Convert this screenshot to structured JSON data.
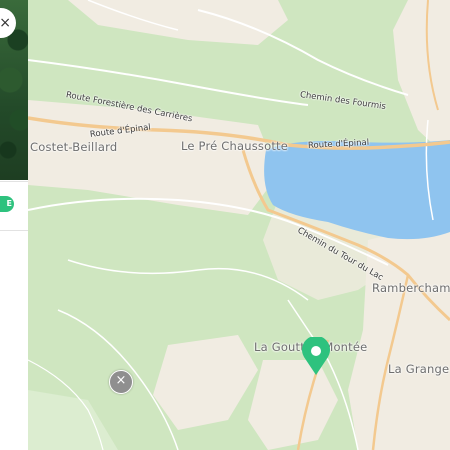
{
  "panel": {
    "close_icon_glyph": "×",
    "pill_text": "E"
  },
  "map": {
    "places": {
      "costet_beillard": "Costet-Beillard",
      "le_pre_chaussotte": "Le Pré Chaussotte",
      "rambercham": "Rambercham",
      "la_goutte_montee": "La Goutt    la Montée",
      "la_grange": "La Grange"
    },
    "roads": {
      "route_forestiere": "Route Forestière des Carrières",
      "chemin_des_fourmis": "Chemin des Fourmis",
      "route_epinal_west": "Route d'Épinal",
      "route_epinal_east": "Route d'Épinal",
      "chemin_tour_du_lac": "Chemin du Tour du Lac"
    },
    "colors": {
      "forest": "#cfe6c0",
      "field": "#f1ece2",
      "lake": "#8fc4ef",
      "major_road": "#f3c98f",
      "minor_road": "#ffffff",
      "marker": "#2ec27e"
    },
    "remove_glyph": "×"
  }
}
